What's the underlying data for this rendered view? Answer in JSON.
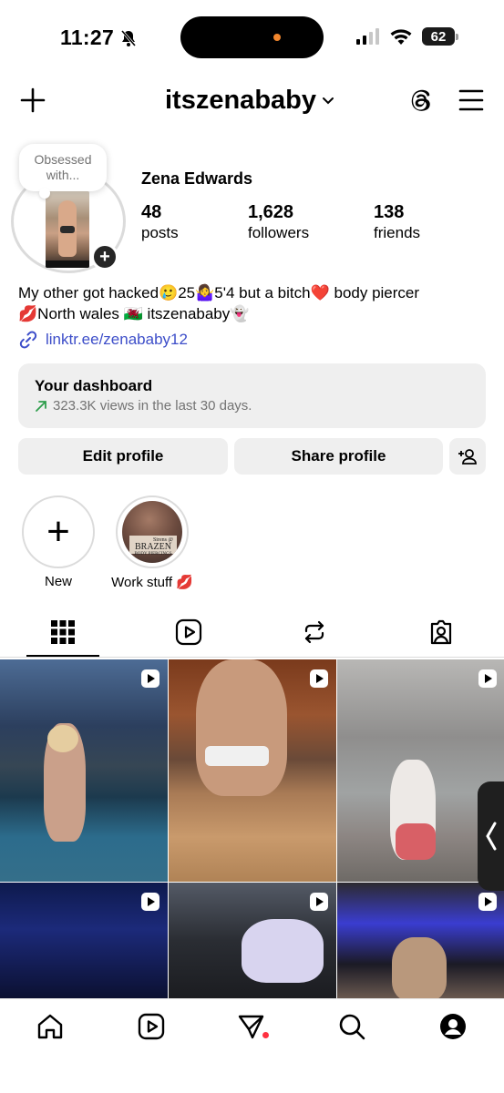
{
  "status_bar": {
    "time": "11:27",
    "battery": "62"
  },
  "header": {
    "username": "itszenababy"
  },
  "profile": {
    "note": "Obsessed with...",
    "display_name": "Zena Edwards",
    "stats": [
      {
        "value": "48",
        "label": "posts"
      },
      {
        "value": "1,628",
        "label": "followers"
      },
      {
        "value": "138",
        "label": "friends"
      }
    ],
    "bio_line1": "My other got hacked🥲25🤷‍♀️5'4 but a bitch❤️ body piercer",
    "bio_line2": "💋North wales 🏴󠁧󠁢󠁷󠁬󠁳󠁿 itszenababy👻",
    "link": "linktr.ee/zenababy12"
  },
  "dashboard": {
    "title": "Your dashboard",
    "subtitle": "323.3K views in the last 30 days."
  },
  "buttons": {
    "edit": "Edit profile",
    "share": "Share profile"
  },
  "highlights": [
    {
      "label": "New"
    },
    {
      "label": "Work stuff 💋",
      "cover_text_top": "Sirens @",
      "cover_text_main": "BRAZEN",
      "cover_text_bottom": "BODY PIERCINGS"
    }
  ],
  "tabs": [
    "grid-icon",
    "reels-icon",
    "reposts-icon",
    "tagged-icon"
  ],
  "grid_posts": [
    {
      "type": "reel"
    },
    {
      "type": "reel"
    },
    {
      "type": "reel"
    },
    {
      "type": "reel"
    },
    {
      "type": "reel"
    },
    {
      "type": "reel"
    }
  ],
  "colors": {
    "link": "#3d4ec9",
    "notification_dot": "#ff3040",
    "island_indicator": "#f2862d",
    "button_bg": "#efefef"
  }
}
